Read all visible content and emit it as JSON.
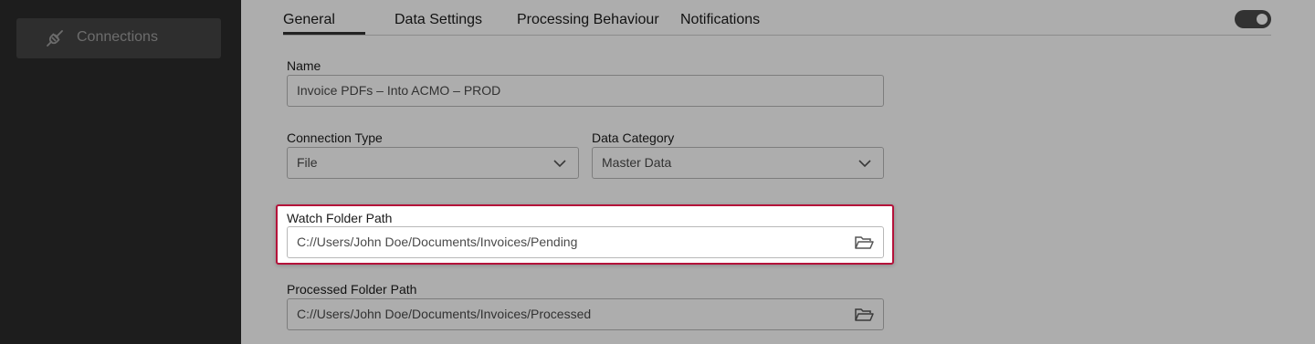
{
  "sidebar": {
    "items": [
      {
        "label": "Connections",
        "icon": "plug-icon"
      }
    ]
  },
  "tabs": [
    {
      "label": "General",
      "active": true
    },
    {
      "label": "Data Settings"
    },
    {
      "label": "Processing Behaviour"
    },
    {
      "label": "Notifications"
    }
  ],
  "toggle": {
    "on": true
  },
  "form": {
    "name": {
      "label": "Name",
      "value": "Invoice PDFs – Into ACMO – PROD"
    },
    "connection_type": {
      "label": "Connection Type",
      "value": "File"
    },
    "data_category": {
      "label": "Data Category",
      "value": "Master Data"
    },
    "watch_folder": {
      "label": "Watch Folder Path",
      "value": "C://Users/John Doe/Documents/Invoices/Pending"
    },
    "processed_folder": {
      "label": "Processed Folder Path",
      "value": "C://Users/John Doe/Documents/Invoices/Processed"
    }
  },
  "colors": {
    "highlight_border": "#b4123a",
    "sidebar_bg": "#2b2b2b",
    "overlay": "rgba(0,0,0,0.32)"
  }
}
